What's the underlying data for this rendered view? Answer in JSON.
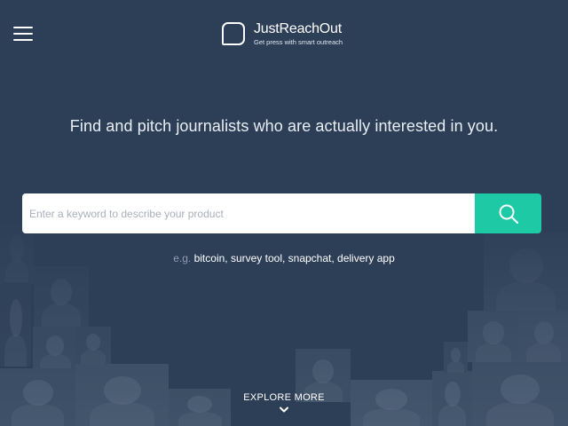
{
  "header": {
    "menu_icon": "hamburger-menu-icon",
    "logo_icon": "speech-bubble-icon",
    "brand_name": "JustReachOut",
    "tagline": "Get press with smart outreach"
  },
  "hero": {
    "headline": "Find and pitch journalists who are actually interested in you."
  },
  "search": {
    "placeholder": "Enter a keyword to describe your product",
    "value": "",
    "button_icon": "search-icon"
  },
  "examples": {
    "prefix": "e.g.",
    "items": [
      "bitcoin",
      "survey tool",
      "snapchat",
      "delivery app"
    ],
    "separator": ","
  },
  "explore": {
    "label": "EXPLORE MORE",
    "icon": "chevron-down-icon"
  },
  "colors": {
    "background": "#2d3f57",
    "accent": "#1ec9a6",
    "text": "#ffffff"
  }
}
